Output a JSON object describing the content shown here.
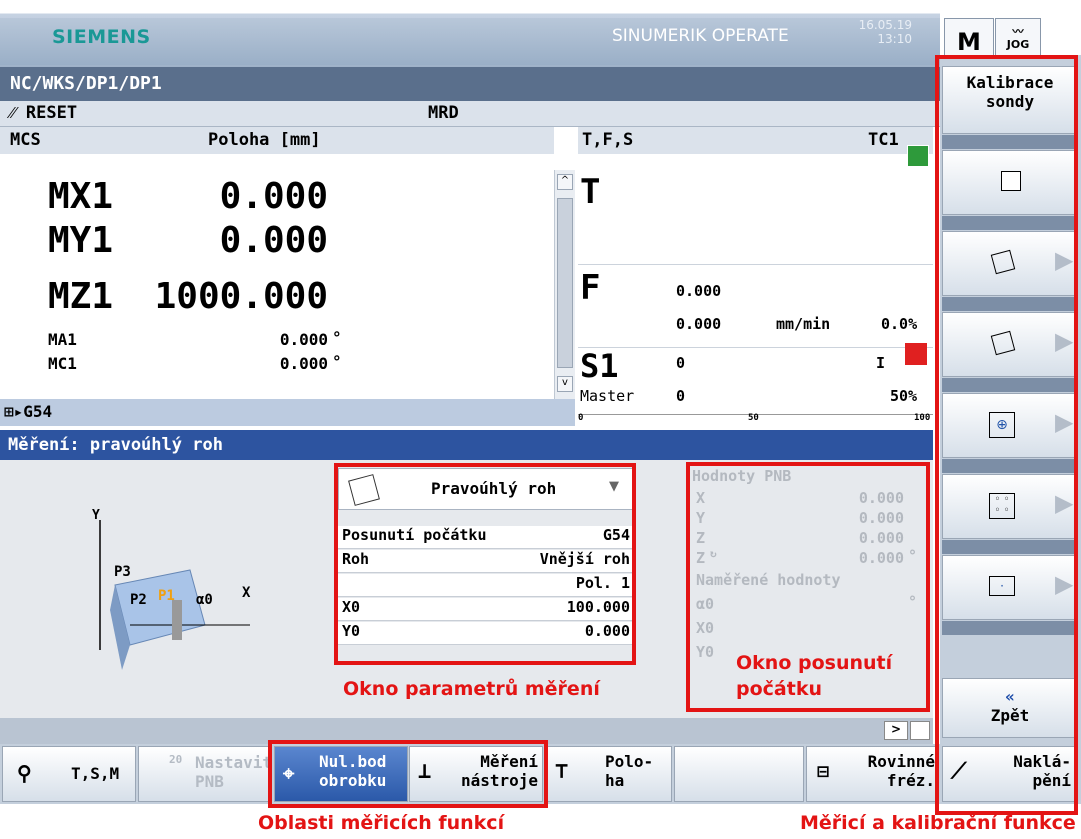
{
  "header": {
    "brand": "SIEMENS",
    "product": "SINUMERIK OPERATE",
    "date": "16.05.19",
    "time": "13:10",
    "mode_m": "M",
    "mode_jog": "JOG"
  },
  "path": "NC/WKS/DP1/DP1",
  "status": {
    "reset": "RESET",
    "mrd": "MRD"
  },
  "mcs": {
    "label": "MCS",
    "col": "Poloha [mm]",
    "axes": [
      {
        "name": "MX1",
        "value": "0.000"
      },
      {
        "name": "MY1",
        "value": "0.000"
      },
      {
        "name": "MZ1",
        "value": "1000.000"
      },
      {
        "name": "MA1",
        "value": "0.000",
        "unit": "°"
      },
      {
        "name": "MC1",
        "value": "0.000",
        "unit": "°"
      }
    ],
    "frame": "G54"
  },
  "tfs": {
    "label": "T,F,S",
    "tc": "TC1",
    "t": "T",
    "f": "F",
    "f_val1": "0.000",
    "f_val2": "0.000",
    "f_unit": "mm/min",
    "f_pct": "0.0%",
    "s": "S1",
    "s_val": "0",
    "s_dir": "I",
    "master": "Master",
    "master_val": "0",
    "master_pct": "50%",
    "tick0": "0",
    "tick50": "50",
    "tick100": "100"
  },
  "measure": {
    "title": "Měření: pravoúhlý roh",
    "diagram": {
      "y": "Y",
      "x": "X",
      "p3": "P3",
      "p2": "P2",
      "p1": "P1",
      "a0": "α0"
    },
    "select": "Pravoúhlý roh",
    "rows": [
      {
        "label": "Posunutí počátku",
        "value": "G54"
      },
      {
        "label": "Roh",
        "value": "Vnější roh"
      },
      {
        "label": "",
        "value": "Pol. 1"
      },
      {
        "label": "X0",
        "value": "100.000"
      },
      {
        "label": "Y0",
        "value": "0.000"
      }
    ],
    "pnb_title": "Hodnoty PNB",
    "pnb": [
      {
        "l": "X",
        "v": "0.000"
      },
      {
        "l": "Y",
        "v": "0.000"
      },
      {
        "l": "Z",
        "v": "0.000"
      },
      {
        "l": "Z",
        "v": "0.000",
        "u": "°"
      }
    ],
    "meas_title": "Naměřené hodnoty",
    "meas": [
      {
        "l": "α0",
        "u": "°"
      },
      {
        "l": "X0"
      },
      {
        "l": "Y0"
      }
    ]
  },
  "vsoftkeys": {
    "top": "Kalibrace sondy",
    "back": "Zpět"
  },
  "hsoftkeys": [
    {
      "label": "T,S,M"
    },
    {
      "label": "Nastavit PNB",
      "num": "20"
    },
    {
      "label": "Nul.bod obrobku"
    },
    {
      "label": "Měření nástroje"
    },
    {
      "label": "Polo-ha"
    },
    {
      "label": "Rovinné fréz."
    },
    {
      "label": "Naklá-pění"
    }
  ],
  "annotations": {
    "params": "Okno parametrů měření",
    "offset": "Okno posunutí počátku",
    "areas": "Oblasti měřicích funkcí",
    "calib": "Měřicí a kalibrační funkce"
  }
}
